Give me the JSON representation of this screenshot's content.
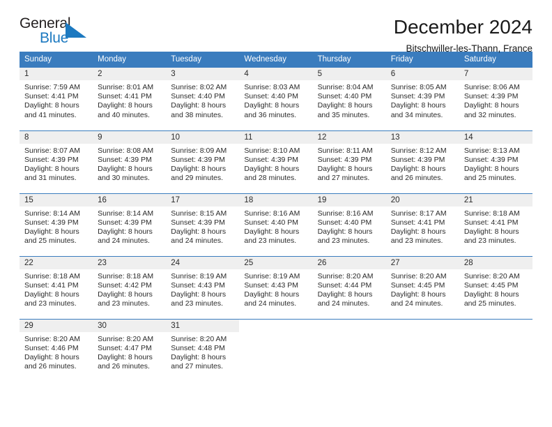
{
  "brand": {
    "name_top": "General",
    "name_bottom": "Blue",
    "triangle_icon": "triangle-icon",
    "accent_color": "#1c79c0"
  },
  "header": {
    "title": "December 2024",
    "location": "Bitschwiller-les-Thann, France"
  },
  "theme": {
    "header_blue": "#3a7cbe",
    "daynum_band": "#efefef",
    "text": "#2a2a2a"
  },
  "weekday_headers": [
    "Sunday",
    "Monday",
    "Tuesday",
    "Wednesday",
    "Thursday",
    "Friday",
    "Saturday"
  ],
  "labels": {
    "sunrise_prefix": "Sunrise:",
    "sunset_prefix": "Sunset:",
    "daylight_prefix": "Daylight:"
  },
  "weeks": [
    [
      {
        "day": "1",
        "sunrise": "Sunrise: 7:59 AM",
        "sunset": "Sunset: 4:41 PM",
        "daylight_l1": "Daylight: 8 hours",
        "daylight_l2": "and 41 minutes."
      },
      {
        "day": "2",
        "sunrise": "Sunrise: 8:01 AM",
        "sunset": "Sunset: 4:41 PM",
        "daylight_l1": "Daylight: 8 hours",
        "daylight_l2": "and 40 minutes."
      },
      {
        "day": "3",
        "sunrise": "Sunrise: 8:02 AM",
        "sunset": "Sunset: 4:40 PM",
        "daylight_l1": "Daylight: 8 hours",
        "daylight_l2": "and 38 minutes."
      },
      {
        "day": "4",
        "sunrise": "Sunrise: 8:03 AM",
        "sunset": "Sunset: 4:40 PM",
        "daylight_l1": "Daylight: 8 hours",
        "daylight_l2": "and 36 minutes."
      },
      {
        "day": "5",
        "sunrise": "Sunrise: 8:04 AM",
        "sunset": "Sunset: 4:40 PM",
        "daylight_l1": "Daylight: 8 hours",
        "daylight_l2": "and 35 minutes."
      },
      {
        "day": "6",
        "sunrise": "Sunrise: 8:05 AM",
        "sunset": "Sunset: 4:39 PM",
        "daylight_l1": "Daylight: 8 hours",
        "daylight_l2": "and 34 minutes."
      },
      {
        "day": "7",
        "sunrise": "Sunrise: 8:06 AM",
        "sunset": "Sunset: 4:39 PM",
        "daylight_l1": "Daylight: 8 hours",
        "daylight_l2": "and 32 minutes."
      }
    ],
    [
      {
        "day": "8",
        "sunrise": "Sunrise: 8:07 AM",
        "sunset": "Sunset: 4:39 PM",
        "daylight_l1": "Daylight: 8 hours",
        "daylight_l2": "and 31 minutes."
      },
      {
        "day": "9",
        "sunrise": "Sunrise: 8:08 AM",
        "sunset": "Sunset: 4:39 PM",
        "daylight_l1": "Daylight: 8 hours",
        "daylight_l2": "and 30 minutes."
      },
      {
        "day": "10",
        "sunrise": "Sunrise: 8:09 AM",
        "sunset": "Sunset: 4:39 PM",
        "daylight_l1": "Daylight: 8 hours",
        "daylight_l2": "and 29 minutes."
      },
      {
        "day": "11",
        "sunrise": "Sunrise: 8:10 AM",
        "sunset": "Sunset: 4:39 PM",
        "daylight_l1": "Daylight: 8 hours",
        "daylight_l2": "and 28 minutes."
      },
      {
        "day": "12",
        "sunrise": "Sunrise: 8:11 AM",
        "sunset": "Sunset: 4:39 PM",
        "daylight_l1": "Daylight: 8 hours",
        "daylight_l2": "and 27 minutes."
      },
      {
        "day": "13",
        "sunrise": "Sunrise: 8:12 AM",
        "sunset": "Sunset: 4:39 PM",
        "daylight_l1": "Daylight: 8 hours",
        "daylight_l2": "and 26 minutes."
      },
      {
        "day": "14",
        "sunrise": "Sunrise: 8:13 AM",
        "sunset": "Sunset: 4:39 PM",
        "daylight_l1": "Daylight: 8 hours",
        "daylight_l2": "and 25 minutes."
      }
    ],
    [
      {
        "day": "15",
        "sunrise": "Sunrise: 8:14 AM",
        "sunset": "Sunset: 4:39 PM",
        "daylight_l1": "Daylight: 8 hours",
        "daylight_l2": "and 25 minutes."
      },
      {
        "day": "16",
        "sunrise": "Sunrise: 8:14 AM",
        "sunset": "Sunset: 4:39 PM",
        "daylight_l1": "Daylight: 8 hours",
        "daylight_l2": "and 24 minutes."
      },
      {
        "day": "17",
        "sunrise": "Sunrise: 8:15 AM",
        "sunset": "Sunset: 4:39 PM",
        "daylight_l1": "Daylight: 8 hours",
        "daylight_l2": "and 24 minutes."
      },
      {
        "day": "18",
        "sunrise": "Sunrise: 8:16 AM",
        "sunset": "Sunset: 4:40 PM",
        "daylight_l1": "Daylight: 8 hours",
        "daylight_l2": "and 23 minutes."
      },
      {
        "day": "19",
        "sunrise": "Sunrise: 8:16 AM",
        "sunset": "Sunset: 4:40 PM",
        "daylight_l1": "Daylight: 8 hours",
        "daylight_l2": "and 23 minutes."
      },
      {
        "day": "20",
        "sunrise": "Sunrise: 8:17 AM",
        "sunset": "Sunset: 4:41 PM",
        "daylight_l1": "Daylight: 8 hours",
        "daylight_l2": "and 23 minutes."
      },
      {
        "day": "21",
        "sunrise": "Sunrise: 8:18 AM",
        "sunset": "Sunset: 4:41 PM",
        "daylight_l1": "Daylight: 8 hours",
        "daylight_l2": "and 23 minutes."
      }
    ],
    [
      {
        "day": "22",
        "sunrise": "Sunrise: 8:18 AM",
        "sunset": "Sunset: 4:41 PM",
        "daylight_l1": "Daylight: 8 hours",
        "daylight_l2": "and 23 minutes."
      },
      {
        "day": "23",
        "sunrise": "Sunrise: 8:18 AM",
        "sunset": "Sunset: 4:42 PM",
        "daylight_l1": "Daylight: 8 hours",
        "daylight_l2": "and 23 minutes."
      },
      {
        "day": "24",
        "sunrise": "Sunrise: 8:19 AM",
        "sunset": "Sunset: 4:43 PM",
        "daylight_l1": "Daylight: 8 hours",
        "daylight_l2": "and 23 minutes."
      },
      {
        "day": "25",
        "sunrise": "Sunrise: 8:19 AM",
        "sunset": "Sunset: 4:43 PM",
        "daylight_l1": "Daylight: 8 hours",
        "daylight_l2": "and 24 minutes."
      },
      {
        "day": "26",
        "sunrise": "Sunrise: 8:20 AM",
        "sunset": "Sunset: 4:44 PM",
        "daylight_l1": "Daylight: 8 hours",
        "daylight_l2": "and 24 minutes."
      },
      {
        "day": "27",
        "sunrise": "Sunrise: 8:20 AM",
        "sunset": "Sunset: 4:45 PM",
        "daylight_l1": "Daylight: 8 hours",
        "daylight_l2": "and 24 minutes."
      },
      {
        "day": "28",
        "sunrise": "Sunrise: 8:20 AM",
        "sunset": "Sunset: 4:45 PM",
        "daylight_l1": "Daylight: 8 hours",
        "daylight_l2": "and 25 minutes."
      }
    ],
    [
      {
        "day": "29",
        "sunrise": "Sunrise: 8:20 AM",
        "sunset": "Sunset: 4:46 PM",
        "daylight_l1": "Daylight: 8 hours",
        "daylight_l2": "and 26 minutes."
      },
      {
        "day": "30",
        "sunrise": "Sunrise: 8:20 AM",
        "sunset": "Sunset: 4:47 PM",
        "daylight_l1": "Daylight: 8 hours",
        "daylight_l2": "and 26 minutes."
      },
      {
        "day": "31",
        "sunrise": "Sunrise: 8:20 AM",
        "sunset": "Sunset: 4:48 PM",
        "daylight_l1": "Daylight: 8 hours",
        "daylight_l2": "and 27 minutes."
      },
      {
        "day": "",
        "sunrise": "",
        "sunset": "",
        "daylight_l1": "",
        "daylight_l2": "",
        "blank": true
      },
      {
        "day": "",
        "sunrise": "",
        "sunset": "",
        "daylight_l1": "",
        "daylight_l2": "",
        "blank": true
      },
      {
        "day": "",
        "sunrise": "",
        "sunset": "",
        "daylight_l1": "",
        "daylight_l2": "",
        "blank": true
      },
      {
        "day": "",
        "sunrise": "",
        "sunset": "",
        "daylight_l1": "",
        "daylight_l2": "",
        "blank": true
      }
    ]
  ]
}
